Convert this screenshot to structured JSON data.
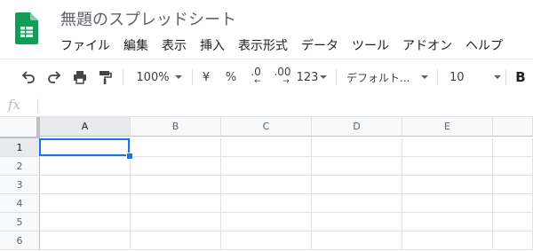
{
  "document": {
    "title": "無題のスプレッドシート"
  },
  "menu": {
    "items": [
      "ファイル",
      "編集",
      "表示",
      "挿入",
      "表示形式",
      "データ",
      "ツール",
      "アドオン",
      "ヘルプ"
    ]
  },
  "toolbar": {
    "zoom": "100%",
    "currency": "¥",
    "percent": "%",
    "decrease_decimal": ".0",
    "increase_decimal": ".00",
    "more_formats": "123",
    "font": "デフォルト...",
    "font_size": "10",
    "bold": "B"
  },
  "formula_bar": {
    "fx_label": "fx",
    "value": ""
  },
  "sheet": {
    "columns": [
      "A",
      "B",
      "C",
      "D",
      "E"
    ],
    "rows": [
      "1",
      "2",
      "3",
      "4",
      "5",
      "6"
    ],
    "active_cell": "A1"
  },
  "colors": {
    "accent": "#1a73e8",
    "sheets_green": "#0f9d58"
  }
}
